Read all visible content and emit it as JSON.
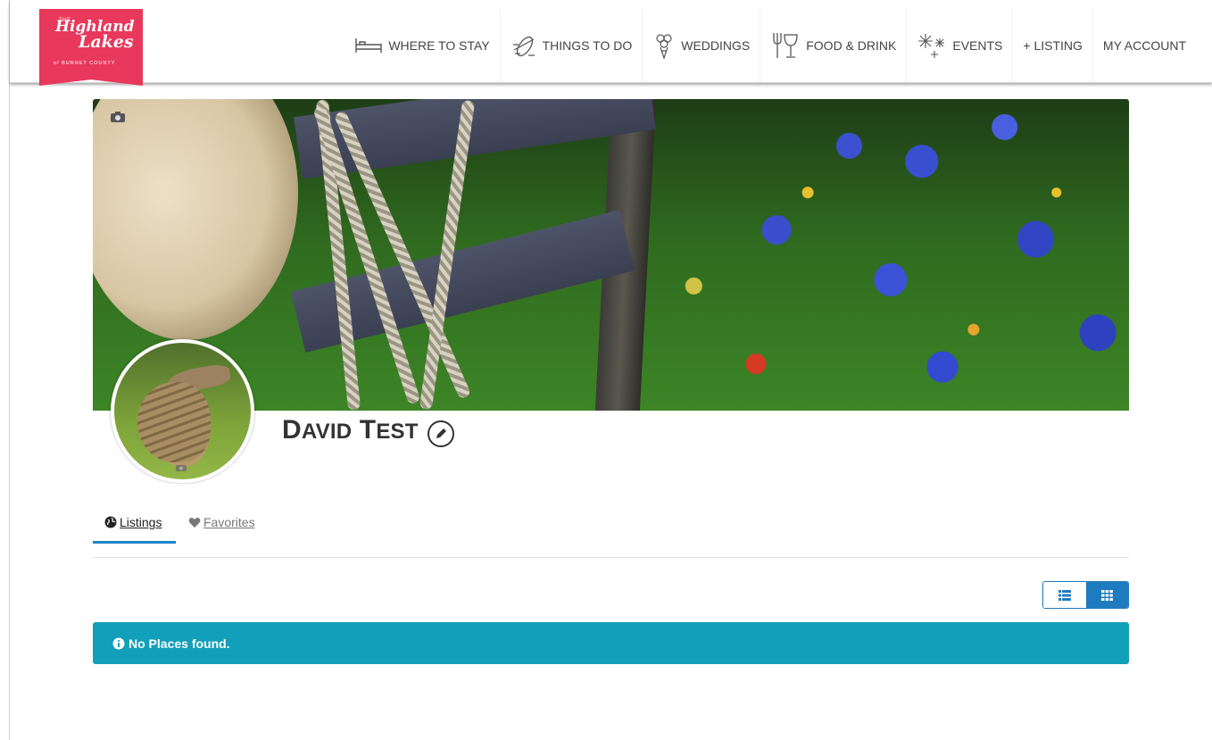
{
  "logo": {
    "the": "THE",
    "line1": "Highland",
    "line2": "Lakes",
    "subtitle": "of BURNET COUNTY"
  },
  "nav": {
    "items": [
      {
        "label": "WHERE TO STAY",
        "icon": "bed-icon"
      },
      {
        "label": "THINGS TO DO",
        "icon": "kayak-icon"
      },
      {
        "label": "WEDDINGS",
        "icon": "bouquet-icon"
      },
      {
        "label": "FOOD & DRINK",
        "icon": "fork-wine-icon"
      },
      {
        "label": "EVENTS",
        "icon": "fireworks-icon"
      },
      {
        "label": "+ LISTING",
        "icon": ""
      },
      {
        "label": "MY ACCOUNT",
        "icon": ""
      }
    ]
  },
  "profile": {
    "name_first": "D",
    "name_first_rest": "AVID",
    "name_last": "T",
    "name_last_rest": "EST"
  },
  "tabs": {
    "listings": "Listings",
    "favorites": "Favorites",
    "active": "listings"
  },
  "view_toggle": {
    "options": [
      "list",
      "grid"
    ],
    "selected": "grid"
  },
  "alert": {
    "message": "No Places found.",
    "color": "#129fb9"
  },
  "colors": {
    "brand": "#e8385c",
    "accent": "#1f7bbf",
    "tab_active": "#1e86c8"
  }
}
